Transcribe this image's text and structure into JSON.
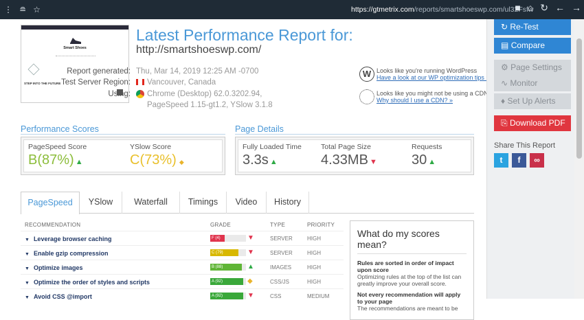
{
  "browser": {
    "url_host": "https://gtmetrix.com",
    "url_path": "/reports/smartshoeswp.com/ul32Fsfw"
  },
  "thumbnail": {
    "brand": "Smart Shoes",
    "tagline": "STEP INTO THE FUTURE"
  },
  "header": {
    "title": "Latest Performance Report for:",
    "site": "http://smartshoeswp.com/"
  },
  "meta": {
    "generated_label": "Report generated:",
    "generated_value": "Thu, Mar 14, 2019 12:25 AM -0700",
    "region_label": "Test Server Region:",
    "region_value": "Vancouver, Canada",
    "using_label": "Using:",
    "using_value_1": "Chrome (Desktop) 62.0.3202.94,",
    "using_value_2": "PageSpeed 1.15-gt1.2, YSlow 3.1.8"
  },
  "cards": {
    "wp_text": "Looks like you're running WordPress",
    "wp_link": "Have a look at our WP optimization tips »",
    "cdn_text": "Looks like you might not be using a CDN",
    "cdn_link": "Why should I use a CDN? »"
  },
  "scores": {
    "heading": "Performance Scores",
    "pagespeed_label": "PageSpeed Score",
    "pagespeed_grade": "B",
    "pagespeed_value": "(87%)",
    "yslow_label": "YSlow Score",
    "yslow_grade": "C",
    "yslow_value": "(73%)"
  },
  "details": {
    "heading": "Page Details",
    "loaded_label": "Fully Loaded Time",
    "loaded_value": "3.3s",
    "size_label": "Total Page Size",
    "size_value": "4.33MB",
    "requests_label": "Requests",
    "requests_value": "30"
  },
  "tabs": [
    "PageSpeed",
    "YSlow",
    "Waterfall",
    "Timings",
    "Video",
    "History"
  ],
  "table": {
    "headers": {
      "rec": "RECOMMENDATION",
      "grade": "GRADE",
      "type": "TYPE",
      "priority": "PRIORITY"
    },
    "rows": [
      {
        "name": "Leverage browser caching",
        "grade": "F (4)",
        "pct": 4,
        "color": "#e0344d",
        "type": "SERVER",
        "priority": "HIGH",
        "trend": "down"
      },
      {
        "name": "Enable gzip compression",
        "grade": "C (79)",
        "pct": 79,
        "color": "#d8b800",
        "type": "SERVER",
        "priority": "HIGH",
        "trend": "down"
      },
      {
        "name": "Optimize images",
        "grade": "B (88)",
        "pct": 88,
        "color": "#5fb536",
        "type": "IMAGES",
        "priority": "HIGH",
        "trend": "up"
      },
      {
        "name": "Optimize the order of styles and scripts",
        "grade": "A (92)",
        "pct": 92,
        "color": "#3aa83a",
        "type": "CSS/JS",
        "priority": "HIGH",
        "trend": "diamond"
      },
      {
        "name": "Avoid CSS @import",
        "grade": "A (92)",
        "pct": 92,
        "color": "#3aa83a",
        "type": "CSS",
        "priority": "MEDIUM",
        "trend": "down"
      }
    ]
  },
  "scorebox": {
    "title": "What do my scores mean?",
    "b1": "Rules are sorted in order of impact upon score",
    "p1": "Optimizing rules at the top of the list can greatly improve your overall score.",
    "b2": "Not every recommendation will apply to your page",
    "p2": "The recommendations are meant to be"
  },
  "sidebar": {
    "retest": "Re-Test",
    "compare": "Compare",
    "settings": "Page Settings",
    "monitor": "Monitor",
    "alerts": "Set Up Alerts",
    "pdf": "Download PDF",
    "share": "Share This Report"
  },
  "colors": {
    "accent": "#4a98d7",
    "sidebar_blue": "#2f86d4",
    "pdf_red": "#e0363f"
  }
}
